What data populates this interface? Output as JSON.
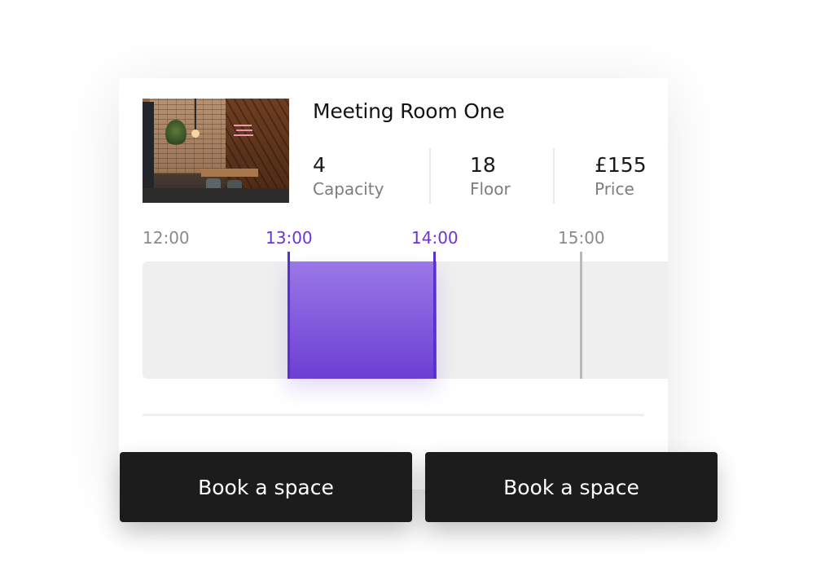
{
  "room": {
    "name": "Meeting Room One",
    "capacity": {
      "value": "4",
      "label": "Capacity"
    },
    "floor": {
      "value": "18",
      "label": "Floor"
    },
    "price": {
      "value": "£155",
      "label": "Price"
    }
  },
  "timeline": {
    "ticks": [
      "12:00",
      "13:00",
      "14:00",
      "15:00"
    ],
    "selection": {
      "start": "13:00",
      "end": "14:00"
    },
    "colors": {
      "selected": "#6b3fd3",
      "selected_label": "#6b35d4",
      "track": "#efefef",
      "marker": "#b9b9b9"
    }
  },
  "actions": {
    "primary_button": "Book a space",
    "secondary_button": "Book a space",
    "button_color": "#1c1c1c"
  }
}
